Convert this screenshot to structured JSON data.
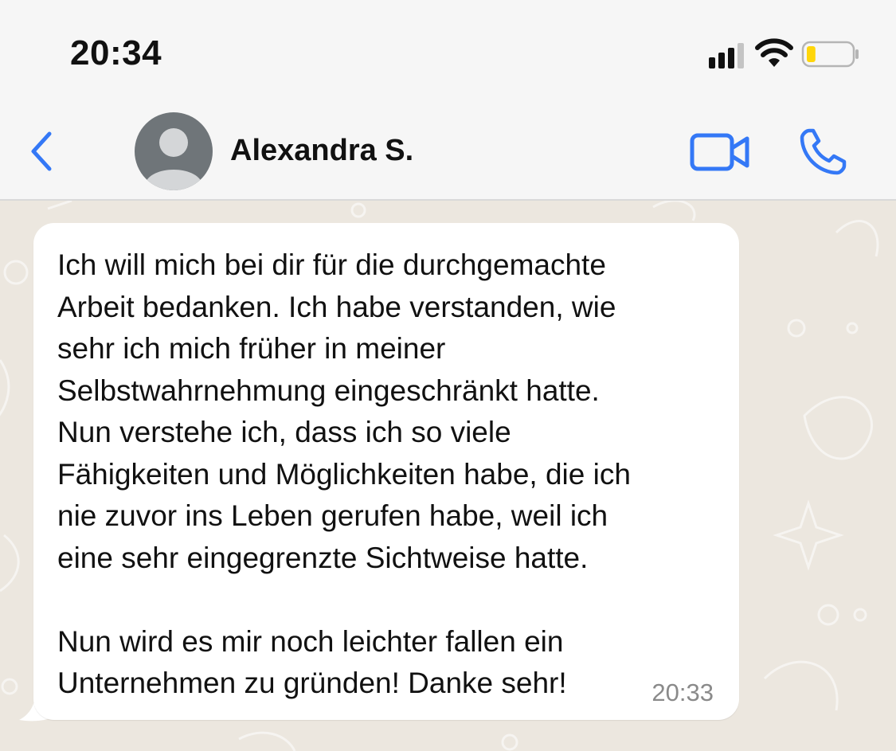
{
  "status_bar": {
    "time": "20:34",
    "signal_icon": "cellular-signal-icon",
    "wifi_icon": "wifi-icon",
    "battery_icon": "battery-icon",
    "battery_level": 0.2,
    "battery_color": "#ffd60a"
  },
  "header": {
    "back_icon": "chevron-left-icon",
    "avatar_icon": "person-placeholder-icon",
    "contact_name": "Alexandra S.",
    "video_call_icon": "video-camera-icon",
    "voice_call_icon": "phone-icon",
    "accent_color": "#3478f6"
  },
  "chat": {
    "messages": [
      {
        "direction": "incoming",
        "text": "Ich will mich bei dir für die durchgemachte\nArbeit bedanken. Ich habe verstanden, wie\nsehr ich mich früher in meiner\nSelbstwahrnehmung eingeschränkt hatte.\nNun verstehe ich, dass ich so viele\nFähigkeiten und Möglichkeiten habe, die ich\nnie zuvor ins Leben gerufen habe, weil ich\neine sehr eingegrenzte Sichtweise hatte.\n\nNun wird es mir noch leichter fallen ein\nUnternehmen zu gründen! Danke sehr!",
        "time": "20:33"
      }
    ]
  }
}
